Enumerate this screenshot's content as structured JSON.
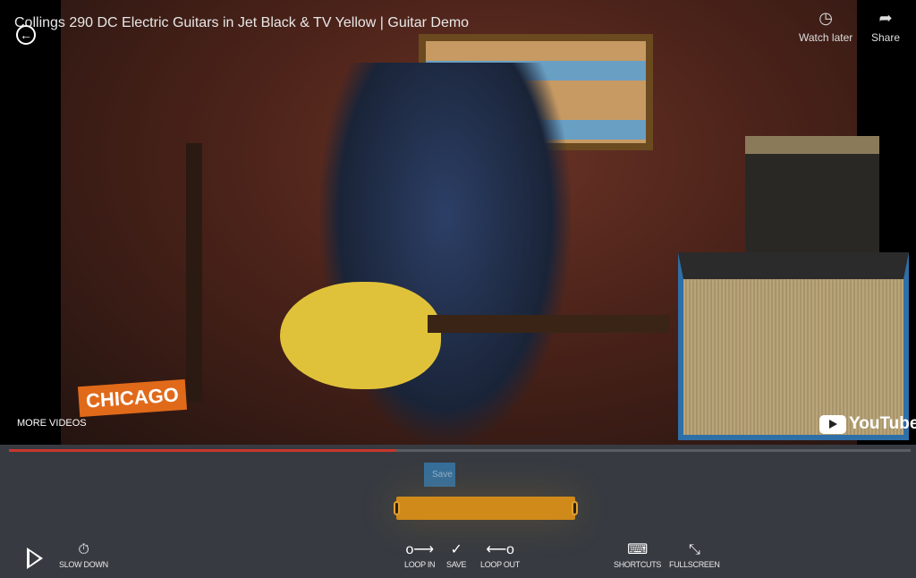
{
  "video": {
    "title": "Collings 290 DC Electric Guitars in Jet Black & TV Yellow | Guitar Demo",
    "watch_later": "Watch later",
    "share": "Share",
    "more_videos": "MORE VIDEOS",
    "youtube": "YouTube",
    "channel_logo": "CHICAGO MUSIC EXCHANGE"
  },
  "progress": {
    "played_percent": 43,
    "played_color": "#c8362e"
  },
  "loop": {
    "save_tooltip": "Save",
    "bar_color": "#cf8a1a"
  },
  "controls": {
    "slow_down": "SLOW DOWN",
    "loop_in": "LOOP IN",
    "save": "SAVE",
    "loop_out": "LOOP OUT",
    "shortcuts": "SHORTCUTS",
    "fullscreen": "FULLSCREEN"
  }
}
